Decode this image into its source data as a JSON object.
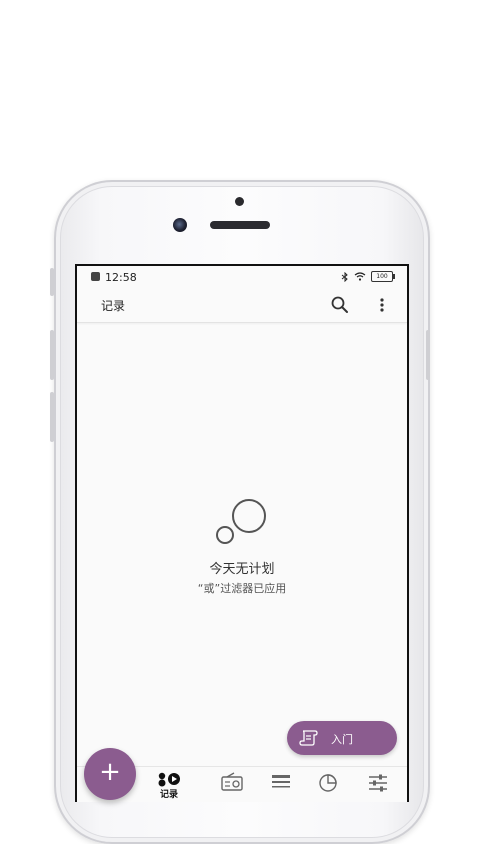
{
  "status_bar": {
    "time": "12:58",
    "battery": "100"
  },
  "app_bar": {
    "title": "记录",
    "search_icon": "search-icon",
    "more_icon": "more-vert-icon"
  },
  "empty_state": {
    "icon": "thought-bubble-icon",
    "title": "今天无计划",
    "subtitle": "“或”过滤器已应用"
  },
  "intro_button": {
    "label": "入门",
    "icon": "scroll-icon"
  },
  "fab": {
    "label": "+"
  },
  "bottom_nav": {
    "items": [
      {
        "label": "记录",
        "icon": "record-icon",
        "active": true
      },
      {
        "label": "",
        "icon": "radio-icon",
        "active": false
      },
      {
        "label": "",
        "icon": "list-icon",
        "active": false
      },
      {
        "label": "",
        "icon": "pie-chart-icon",
        "active": false
      },
      {
        "label": "",
        "icon": "sliders-icon",
        "active": false
      }
    ]
  },
  "colors": {
    "accent": "#8b5c8f",
    "background": "#fafafa"
  }
}
